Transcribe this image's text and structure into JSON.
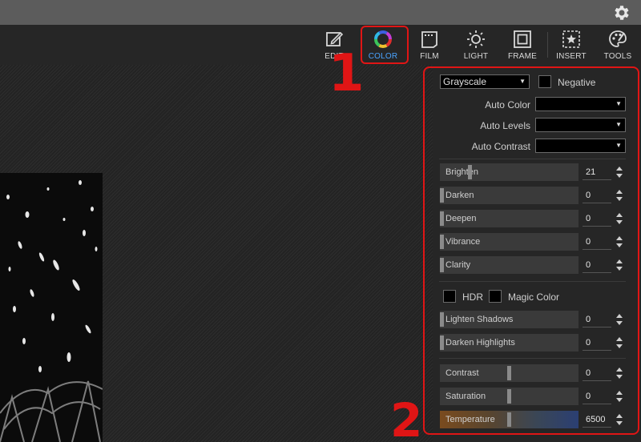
{
  "toolbar": {
    "tools": [
      {
        "id": "edit",
        "label": "EDIT",
        "icon": "edit-icon"
      },
      {
        "id": "color",
        "label": "COLOR",
        "icon": "color-wheel-icon"
      },
      {
        "id": "film",
        "label": "FILM",
        "icon": "film-icon"
      },
      {
        "id": "light",
        "label": "LIGHT",
        "icon": "light-icon"
      },
      {
        "id": "frame",
        "label": "FRAME",
        "icon": "frame-icon"
      },
      {
        "id": "insert",
        "label": "INSERT",
        "icon": "insert-icon"
      },
      {
        "id": "tools",
        "label": "TOOLS",
        "icon": "palette-icon"
      }
    ],
    "active": "color",
    "accent": "#4aa3ff"
  },
  "annotations": {
    "one": "1",
    "two": "2",
    "color": "#e01515"
  },
  "panel": {
    "mode_select": "Grayscale",
    "negative_label": "Negative",
    "auto_color_label": "Auto Color",
    "auto_levels_label": "Auto Levels",
    "auto_contrast_label": "Auto Contrast",
    "hdr_label": "HDR",
    "magic_color_label": "Magic Color",
    "sliders": [
      {
        "label": "Brighten",
        "value": "21"
      },
      {
        "label": "Darken",
        "value": "0"
      },
      {
        "label": "Deepen",
        "value": "0"
      },
      {
        "label": "Vibrance",
        "value": "0"
      },
      {
        "label": "Clarity",
        "value": "0"
      },
      {
        "label": "Lighten Shadows",
        "value": "0"
      },
      {
        "label": "Darken Highlights",
        "value": "0"
      },
      {
        "label": "Contrast",
        "value": "0"
      },
      {
        "label": "Saturation",
        "value": "0"
      },
      {
        "label": "Temperature",
        "value": "6500"
      }
    ]
  }
}
